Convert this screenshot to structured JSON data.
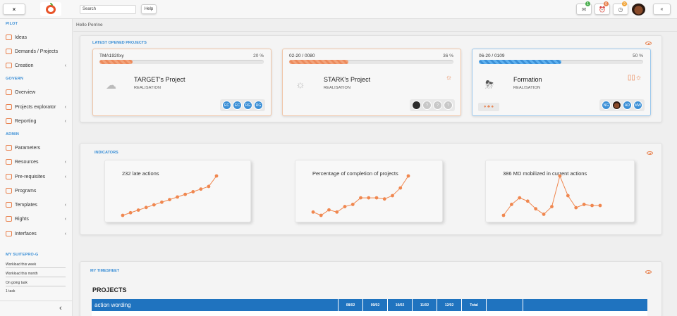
{
  "topbar": {
    "close_label": "×",
    "search_placeholder": "Search",
    "help_label": "Help",
    "icons": [
      {
        "name": "mail-icon",
        "glyph": "✉",
        "badge": "1",
        "badge_color": "#4caf50"
      },
      {
        "name": "alarm-icon",
        "glyph": "⏰",
        "badge": "0",
        "badge_color": "#e8804c"
      },
      {
        "name": "clock-icon",
        "glyph": "◷",
        "badge": "9",
        "badge_color": "#f0a030"
      }
    ],
    "collapse_label": "«"
  },
  "sidebar": {
    "sections": [
      {
        "title": "PILOT",
        "items": [
          {
            "label": "Ideas",
            "chevron": ""
          },
          {
            "label": "Demands / Projects",
            "chevron": ""
          },
          {
            "label": "Creation",
            "chevron": "‹"
          }
        ]
      },
      {
        "title": "GOVERN",
        "items": [
          {
            "label": "Overview",
            "chevron": ""
          },
          {
            "label": "Projects explorator",
            "chevron": "‹"
          },
          {
            "label": "Reporting",
            "chevron": "‹"
          }
        ]
      },
      {
        "title": "ADMIN",
        "items": [
          {
            "label": "Parameters",
            "chevron": ""
          },
          {
            "label": "Resources",
            "chevron": "‹"
          },
          {
            "label": "Pre-requisites",
            "chevron": "‹"
          },
          {
            "label": "Programs",
            "chevron": ""
          },
          {
            "label": "Templates",
            "chevron": "‹"
          },
          {
            "label": "Rights",
            "chevron": "‹"
          },
          {
            "label": "Interfaces",
            "chevron": "‹"
          }
        ]
      }
    ],
    "suitepro": {
      "title": "MY SUITEPRO-G",
      "rows": [
        "Workload this week",
        "Workload this month",
        "On going task",
        "1 task"
      ]
    },
    "bottom_chevron": "‹"
  },
  "main": {
    "greeting": "Hello Perrine",
    "latest": {
      "title": "LATEST OPENED PROJECTS",
      "projects": [
        {
          "code": "TMA1920xy",
          "percent_label": "20 %",
          "progress": 0.2,
          "name": "TARGET's Project",
          "status": "REALISATION",
          "weather": "☁",
          "status_icon": "",
          "members": [
            "EC",
            "EC",
            "RG",
            "RG"
          ],
          "mini": ""
        },
        {
          "code": "02-20 / 0080",
          "percent_label": "36 %",
          "progress": 0.36,
          "name": "STARK's Project",
          "status": "REALISATION",
          "weather": "☼",
          "status_icon": "☼",
          "members": [
            "",
            "?",
            "?",
            "?"
          ],
          "mini": ""
        },
        {
          "code": "06-20 / 0109",
          "percent_label": "50 %",
          "progress": 0.5,
          "name": "Formation",
          "status": "REALISATION",
          "weather": "⛈",
          "status_icon": "▯▯☼",
          "members": [
            "NG",
            "",
            "AD",
            "MW"
          ],
          "mini": "♦ ♣ ♠"
        }
      ]
    },
    "indicators": {
      "title": "INDICATORS",
      "cards": [
        {
          "title": "232 late actions"
        },
        {
          "title": "Percentage of completion of projects"
        },
        {
          "title": "386 MD mobilized in current actions"
        }
      ]
    },
    "timesheet": {
      "title": "MY TIMESHEET",
      "subtitle": "PROJECTS",
      "columns": [
        "action wording",
        "08/02",
        "09/02",
        "10/02",
        "11/02",
        "12/02",
        "Total"
      ]
    }
  },
  "chart_data": [
    {
      "type": "line",
      "title": "232 late actions",
      "values": [
        0,
        1,
        2,
        3,
        4,
        5,
        6,
        7,
        8,
        9,
        10,
        11,
        15
      ],
      "color": "#f0874f"
    },
    {
      "type": "line",
      "title": "Percentage of completion of projects",
      "values": [
        5,
        2,
        7,
        5,
        10,
        12,
        18,
        18,
        18,
        17,
        20,
        27,
        38
      ],
      "color": "#f0874f"
    },
    {
      "type": "line",
      "title": "386 MD mobilized in current actions",
      "values": [
        2,
        12,
        18,
        15,
        8,
        3,
        10,
        38,
        20,
        9,
        12,
        11,
        11
      ],
      "color": "#f0874f"
    }
  ],
  "colors": {
    "accent": "#3b8fd6",
    "orange": "#e8804c",
    "header_blue": "#1f73bf"
  }
}
